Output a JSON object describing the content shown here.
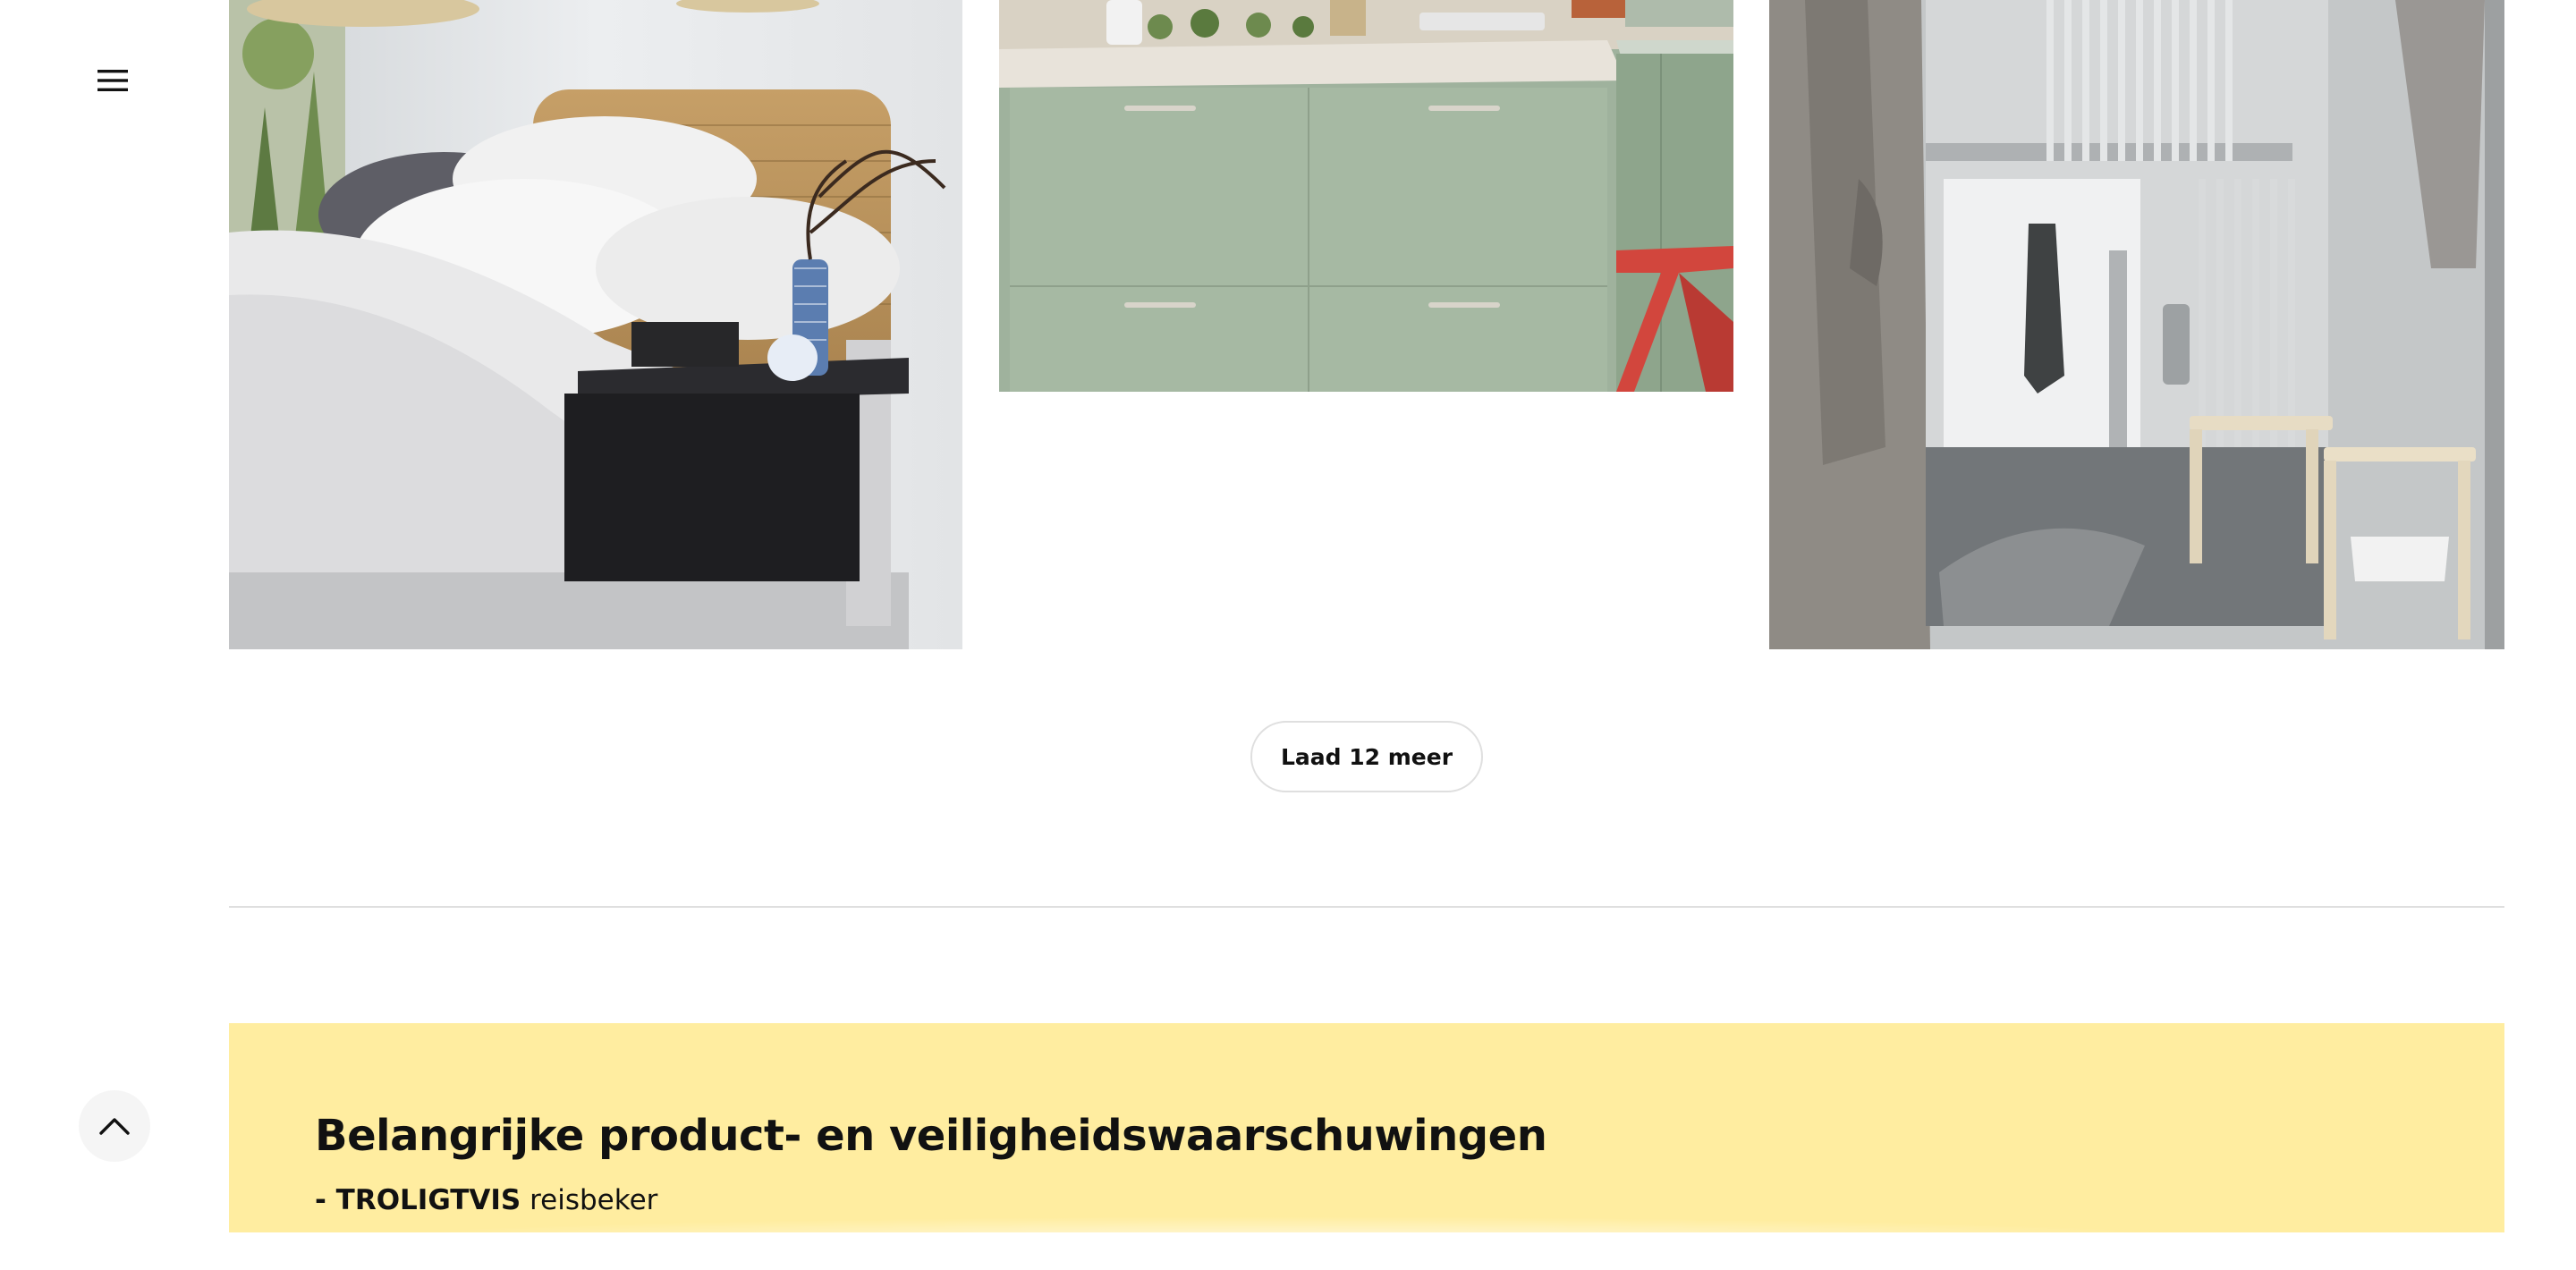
{
  "nav": {
    "menu_icon": "hamburger-menu-icon"
  },
  "gallery": {
    "tiles": [
      {
        "name": "bedroom",
        "theme_colors": [
          "#d8d9dc",
          "#c49a5c",
          "#1f1f22"
        ]
      },
      {
        "name": "kitchen",
        "theme_colors": [
          "#a8bba6",
          "#e9e4dc",
          "#d9423e"
        ]
      },
      {
        "name": "bathroom",
        "theme_colors": [
          "#bdbfc0",
          "#8d8a86",
          "#e7dcc4"
        ]
      }
    ],
    "load_more_label": "Laad 12 meer"
  },
  "warnings": {
    "title": "Belangrijke product- en veiligheidswaarschuwingen",
    "items": [
      {
        "prefix": "- ",
        "product": "TROLIGTVIS",
        "description": " reisbeker"
      },
      {
        "prefix": "- ",
        "product": "",
        "description": ""
      }
    ],
    "background_color": "#ffeda0"
  },
  "back_to_top": {
    "icon": "chevron-up-icon"
  }
}
